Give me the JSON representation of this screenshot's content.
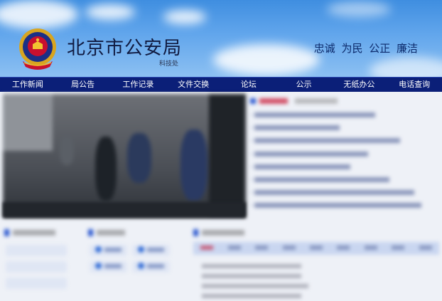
{
  "header": {
    "site_title": "北京市公安局",
    "department": "科技处",
    "motto": "忠诚 为民 公正 廉洁"
  },
  "nav": {
    "items": [
      "工作新闻",
      "局公告",
      "工作记录",
      "文件交换",
      "论坛",
      "公示",
      "无纸办公",
      "电话查询"
    ]
  },
  "colors": {
    "nav_bg": "#0b1f78",
    "sky_top": "#3f8ee0",
    "headline_red": "#c8102e"
  },
  "icons": [
    "police-emblem-icon"
  ]
}
